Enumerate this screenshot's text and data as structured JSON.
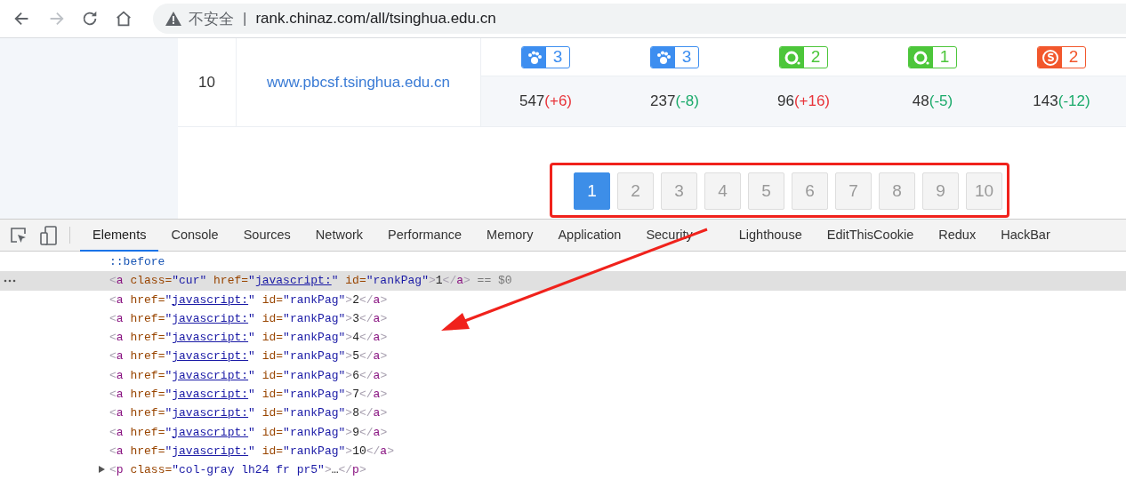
{
  "browser": {
    "nav_buttons": [
      {
        "kind": "back",
        "disabled": false
      },
      {
        "kind": "forward",
        "disabled": true
      },
      {
        "kind": "reload",
        "disabled": false
      },
      {
        "kind": "home",
        "disabled": false
      }
    ],
    "security_label": "不安全",
    "separator": "|",
    "url": "rank.chinaz.com/all/tsinghua.edu.cn"
  },
  "rank_row": {
    "rank": "10",
    "domain": "www.pbcsf.tsinghua.edu.cn",
    "badges": [
      {
        "kind": "paw",
        "value": "3",
        "color": "#3d8ef0"
      },
      {
        "kind": "paw",
        "value": "3",
        "color": "#3d8ef0"
      },
      {
        "kind": "ring",
        "value": "2",
        "color": "#4cc63a"
      },
      {
        "kind": "ring",
        "value": "1",
        "color": "#4cc63a"
      },
      {
        "kind": "sogou",
        "value": "2",
        "color": "#f2572c"
      }
    ],
    "counts": [
      {
        "value": "547",
        "change": "(+6)",
        "kind": "rise"
      },
      {
        "value": "237",
        "change": "(-8)",
        "kind": "fall"
      },
      {
        "value": "96",
        "change": "(+16)",
        "kind": "rise"
      },
      {
        "value": "48",
        "change": "(-5)",
        "kind": "fall"
      },
      {
        "value": "143",
        "change": "(-12)",
        "kind": "fall"
      }
    ]
  },
  "pagination": [
    {
      "label": "1",
      "selected": true
    },
    {
      "label": "2",
      "selected": false
    },
    {
      "label": "3",
      "selected": false
    },
    {
      "label": "4",
      "selected": false
    },
    {
      "label": "5",
      "selected": false
    },
    {
      "label": "6",
      "selected": false
    },
    {
      "label": "7",
      "selected": false
    },
    {
      "label": "8",
      "selected": false
    },
    {
      "label": "9",
      "selected": false
    },
    {
      "label": "10",
      "selected": false
    }
  ],
  "devtools": {
    "tabs": [
      {
        "label": "Elements",
        "selected": true
      },
      {
        "label": "Console",
        "selected": false
      },
      {
        "label": "Sources",
        "selected": false
      },
      {
        "label": "Network",
        "selected": false
      },
      {
        "label": "Performance",
        "selected": false
      },
      {
        "label": "Memory",
        "selected": false
      },
      {
        "label": "Application",
        "selected": false
      },
      {
        "label": "Security",
        "selected": false
      },
      {
        "label": "Lighthouse",
        "selected": false
      },
      {
        "label": "EditThisCookie",
        "selected": false
      },
      {
        "label": "Redux",
        "selected": false
      },
      {
        "label": "HackBar",
        "selected": false
      }
    ],
    "lines": [
      {
        "kind": "pseudo",
        "selected": false,
        "tokens": [
          {
            "kind": "pseudo",
            "text": "::before"
          }
        ]
      },
      {
        "kind": "element",
        "selected": true,
        "tokens": [
          {
            "kind": "bracket",
            "text": "<"
          },
          {
            "kind": "tag",
            "text": "a"
          },
          {
            "kind": "attr",
            "text": " class="
          },
          {
            "kind": "value",
            "text": "\"cur\""
          },
          {
            "kind": "attr",
            "text": " href="
          },
          {
            "kind": "value",
            "text": "\""
          },
          {
            "kind": "link",
            "text": "javascript:"
          },
          {
            "kind": "value",
            "text": "\""
          },
          {
            "kind": "attr",
            "text": " id="
          },
          {
            "kind": "value",
            "text": "\"rankPag\""
          },
          {
            "kind": "bracket",
            "text": ">"
          },
          {
            "kind": "text",
            "text": "1"
          },
          {
            "kind": "bracket",
            "text": "</"
          },
          {
            "kind": "tag",
            "text": "a"
          },
          {
            "kind": "bracket",
            "text": ">"
          },
          {
            "kind": "dim",
            "text": " == $0"
          }
        ]
      },
      {
        "kind": "element",
        "selected": false,
        "tokens": [
          {
            "kind": "bracket",
            "text": "<"
          },
          {
            "kind": "tag",
            "text": "a"
          },
          {
            "kind": "attr",
            "text": " href="
          },
          {
            "kind": "value",
            "text": "\""
          },
          {
            "kind": "link",
            "text": "javascript:"
          },
          {
            "kind": "value",
            "text": "\""
          },
          {
            "kind": "attr",
            "text": " id="
          },
          {
            "kind": "value",
            "text": "\"rankPag\""
          },
          {
            "kind": "bracket",
            "text": ">"
          },
          {
            "kind": "text",
            "text": "2"
          },
          {
            "kind": "bracket",
            "text": "</"
          },
          {
            "kind": "tag",
            "text": "a"
          },
          {
            "kind": "bracket",
            "text": ">"
          }
        ]
      },
      {
        "kind": "element",
        "selected": false,
        "tokens": [
          {
            "kind": "bracket",
            "text": "<"
          },
          {
            "kind": "tag",
            "text": "a"
          },
          {
            "kind": "attr",
            "text": " href="
          },
          {
            "kind": "value",
            "text": "\""
          },
          {
            "kind": "link",
            "text": "javascript:"
          },
          {
            "kind": "value",
            "text": "\""
          },
          {
            "kind": "attr",
            "text": " id="
          },
          {
            "kind": "value",
            "text": "\"rankPag\""
          },
          {
            "kind": "bracket",
            "text": ">"
          },
          {
            "kind": "text",
            "text": "3"
          },
          {
            "kind": "bracket",
            "text": "</"
          },
          {
            "kind": "tag",
            "text": "a"
          },
          {
            "kind": "bracket",
            "text": ">"
          }
        ]
      },
      {
        "kind": "element",
        "selected": false,
        "tokens": [
          {
            "kind": "bracket",
            "text": "<"
          },
          {
            "kind": "tag",
            "text": "a"
          },
          {
            "kind": "attr",
            "text": " href="
          },
          {
            "kind": "value",
            "text": "\""
          },
          {
            "kind": "link",
            "text": "javascript:"
          },
          {
            "kind": "value",
            "text": "\""
          },
          {
            "kind": "attr",
            "text": " id="
          },
          {
            "kind": "value",
            "text": "\"rankPag\""
          },
          {
            "kind": "bracket",
            "text": ">"
          },
          {
            "kind": "text",
            "text": "4"
          },
          {
            "kind": "bracket",
            "text": "</"
          },
          {
            "kind": "tag",
            "text": "a"
          },
          {
            "kind": "bracket",
            "text": ">"
          }
        ]
      },
      {
        "kind": "element",
        "selected": false,
        "tokens": [
          {
            "kind": "bracket",
            "text": "<"
          },
          {
            "kind": "tag",
            "text": "a"
          },
          {
            "kind": "attr",
            "text": " href="
          },
          {
            "kind": "value",
            "text": "\""
          },
          {
            "kind": "link",
            "text": "javascript:"
          },
          {
            "kind": "value",
            "text": "\""
          },
          {
            "kind": "attr",
            "text": " id="
          },
          {
            "kind": "value",
            "text": "\"rankPag\""
          },
          {
            "kind": "bracket",
            "text": ">"
          },
          {
            "kind": "text",
            "text": "5"
          },
          {
            "kind": "bracket",
            "text": "</"
          },
          {
            "kind": "tag",
            "text": "a"
          },
          {
            "kind": "bracket",
            "text": ">"
          }
        ]
      },
      {
        "kind": "element",
        "selected": false,
        "tokens": [
          {
            "kind": "bracket",
            "text": "<"
          },
          {
            "kind": "tag",
            "text": "a"
          },
          {
            "kind": "attr",
            "text": " href="
          },
          {
            "kind": "value",
            "text": "\""
          },
          {
            "kind": "link",
            "text": "javascript:"
          },
          {
            "kind": "value",
            "text": "\""
          },
          {
            "kind": "attr",
            "text": " id="
          },
          {
            "kind": "value",
            "text": "\"rankPag\""
          },
          {
            "kind": "bracket",
            "text": ">"
          },
          {
            "kind": "text",
            "text": "6"
          },
          {
            "kind": "bracket",
            "text": "</"
          },
          {
            "kind": "tag",
            "text": "a"
          },
          {
            "kind": "bracket",
            "text": ">"
          }
        ]
      },
      {
        "kind": "element",
        "selected": false,
        "tokens": [
          {
            "kind": "bracket",
            "text": "<"
          },
          {
            "kind": "tag",
            "text": "a"
          },
          {
            "kind": "attr",
            "text": " href="
          },
          {
            "kind": "value",
            "text": "\""
          },
          {
            "kind": "link",
            "text": "javascript:"
          },
          {
            "kind": "value",
            "text": "\""
          },
          {
            "kind": "attr",
            "text": " id="
          },
          {
            "kind": "value",
            "text": "\"rankPag\""
          },
          {
            "kind": "bracket",
            "text": ">"
          },
          {
            "kind": "text",
            "text": "7"
          },
          {
            "kind": "bracket",
            "text": "</"
          },
          {
            "kind": "tag",
            "text": "a"
          },
          {
            "kind": "bracket",
            "text": ">"
          }
        ]
      },
      {
        "kind": "element",
        "selected": false,
        "tokens": [
          {
            "kind": "bracket",
            "text": "<"
          },
          {
            "kind": "tag",
            "text": "a"
          },
          {
            "kind": "attr",
            "text": " href="
          },
          {
            "kind": "value",
            "text": "\""
          },
          {
            "kind": "link",
            "text": "javascript:"
          },
          {
            "kind": "value",
            "text": "\""
          },
          {
            "kind": "attr",
            "text": " id="
          },
          {
            "kind": "value",
            "text": "\"rankPag\""
          },
          {
            "kind": "bracket",
            "text": ">"
          },
          {
            "kind": "text",
            "text": "8"
          },
          {
            "kind": "bracket",
            "text": "</"
          },
          {
            "kind": "tag",
            "text": "a"
          },
          {
            "kind": "bracket",
            "text": ">"
          }
        ]
      },
      {
        "kind": "element",
        "selected": false,
        "tokens": [
          {
            "kind": "bracket",
            "text": "<"
          },
          {
            "kind": "tag",
            "text": "a"
          },
          {
            "kind": "attr",
            "text": " href="
          },
          {
            "kind": "value",
            "text": "\""
          },
          {
            "kind": "link",
            "text": "javascript:"
          },
          {
            "kind": "value",
            "text": "\""
          },
          {
            "kind": "attr",
            "text": " id="
          },
          {
            "kind": "value",
            "text": "\"rankPag\""
          },
          {
            "kind": "bracket",
            "text": ">"
          },
          {
            "kind": "text",
            "text": "9"
          },
          {
            "kind": "bracket",
            "text": "</"
          },
          {
            "kind": "tag",
            "text": "a"
          },
          {
            "kind": "bracket",
            "text": ">"
          }
        ]
      },
      {
        "kind": "element",
        "selected": false,
        "tokens": [
          {
            "kind": "bracket",
            "text": "<"
          },
          {
            "kind": "tag",
            "text": "a"
          },
          {
            "kind": "attr",
            "text": " href="
          },
          {
            "kind": "value",
            "text": "\""
          },
          {
            "kind": "link",
            "text": "javascript:"
          },
          {
            "kind": "value",
            "text": "\""
          },
          {
            "kind": "attr",
            "text": " id="
          },
          {
            "kind": "value",
            "text": "\"rankPag\""
          },
          {
            "kind": "bracket",
            "text": ">"
          },
          {
            "kind": "text",
            "text": "10"
          },
          {
            "kind": "bracket",
            "text": "</"
          },
          {
            "kind": "tag",
            "text": "a"
          },
          {
            "kind": "bracket",
            "text": ">"
          }
        ]
      },
      {
        "kind": "collapsed",
        "selected": false,
        "expanded": false,
        "tokens": [
          {
            "kind": "bracket",
            "text": "<"
          },
          {
            "kind": "tag",
            "text": "p"
          },
          {
            "kind": "attr",
            "text": " class="
          },
          {
            "kind": "value",
            "text": "\"col-gray lh24 fr pr5\""
          },
          {
            "kind": "bracket",
            "text": ">"
          },
          {
            "kind": "text",
            "text": "…"
          },
          {
            "kind": "bracket",
            "text": "</"
          },
          {
            "kind": "tag",
            "text": "p"
          },
          {
            "kind": "bracket",
            "text": ">"
          }
        ]
      }
    ]
  }
}
